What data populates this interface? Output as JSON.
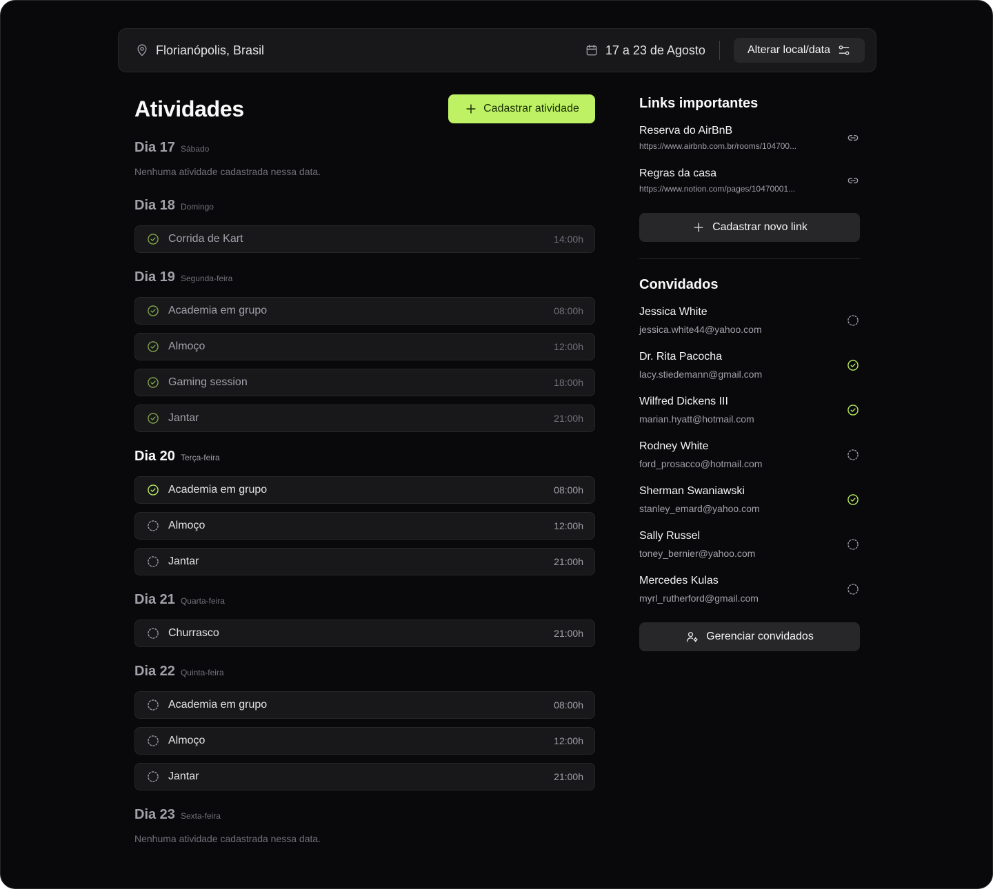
{
  "header": {
    "location": "Florianópolis, Brasil",
    "dates": "17 a 23 de Agosto",
    "change_label": "Alterar local/data"
  },
  "activities": {
    "title": "Atividades",
    "add_label": "Cadastrar atividade",
    "empty_text": "Nenhuma atividade cadastrada nessa data.",
    "days": [
      {
        "label": "Dia 17",
        "weekday": "Sábado",
        "active": false,
        "items": []
      },
      {
        "label": "Dia 18",
        "weekday": "Domingo",
        "active": false,
        "items": [
          {
            "name": "Corrida de Kart",
            "time": "14:00h",
            "done": true,
            "past": true
          }
        ]
      },
      {
        "label": "Dia 19",
        "weekday": "Segunda-feira",
        "active": false,
        "items": [
          {
            "name": "Academia em grupo",
            "time": "08:00h",
            "done": true,
            "past": true
          },
          {
            "name": "Almoço",
            "time": "12:00h",
            "done": true,
            "past": true
          },
          {
            "name": "Gaming session",
            "time": "18:00h",
            "done": true,
            "past": true
          },
          {
            "name": "Jantar",
            "time": "21:00h",
            "done": true,
            "past": true
          }
        ]
      },
      {
        "label": "Dia 20",
        "weekday": "Terça-feira",
        "active": true,
        "items": [
          {
            "name": "Academia em grupo",
            "time": "08:00h",
            "done": true,
            "past": false
          },
          {
            "name": "Almoço",
            "time": "12:00h",
            "done": false,
            "past": false
          },
          {
            "name": "Jantar",
            "time": "21:00h",
            "done": false,
            "past": false
          }
        ]
      },
      {
        "label": "Dia 21",
        "weekday": "Quarta-feira",
        "active": false,
        "items": [
          {
            "name": "Churrasco",
            "time": "21:00h",
            "done": false,
            "past": false
          }
        ]
      },
      {
        "label": "Dia 22",
        "weekday": "Quinta-feira",
        "active": false,
        "items": [
          {
            "name": "Academia em grupo",
            "time": "08:00h",
            "done": false,
            "past": false
          },
          {
            "name": "Almoço",
            "time": "12:00h",
            "done": false,
            "past": false
          },
          {
            "name": "Jantar",
            "time": "21:00h",
            "done": false,
            "past": false
          }
        ]
      },
      {
        "label": "Dia 23",
        "weekday": "Sexta-feira",
        "active": false,
        "items": []
      }
    ]
  },
  "links": {
    "title": "Links importantes",
    "items": [
      {
        "title": "Reserva do AirBnB",
        "url": "https://www.airbnb.com.br/rooms/104700..."
      },
      {
        "title": "Regras da casa",
        "url": "https://www.notion.com/pages/10470001..."
      }
    ],
    "add_label": "Cadastrar novo link"
  },
  "guests": {
    "title": "Convidados",
    "items": [
      {
        "name": "Jessica White",
        "email": "jessica.white44@yahoo.com",
        "confirmed": false
      },
      {
        "name": "Dr. Rita Pacocha",
        "email": "lacy.stiedemann@gmail.com",
        "confirmed": true
      },
      {
        "name": "Wilfred Dickens III",
        "email": "marian.hyatt@hotmail.com",
        "confirmed": true
      },
      {
        "name": "Rodney White",
        "email": "ford_prosacco@hotmail.com",
        "confirmed": false
      },
      {
        "name": "Sherman Swaniawski",
        "email": "stanley_emard@yahoo.com",
        "confirmed": true
      },
      {
        "name": "Sally Russel",
        "email": "toney_bernier@yahoo.com",
        "confirmed": false
      },
      {
        "name": "Mercedes Kulas",
        "email": "myrl_rutherford@gmail.com",
        "confirmed": false
      }
    ],
    "manage_label": "Gerenciar convidados"
  },
  "colors": {
    "accent": "#bef264",
    "check_past": "#84a94a",
    "pending": "#a1a1aa"
  },
  "icons": {
    "location": "map-pin-icon",
    "calendar": "calendar-icon",
    "settings": "sliders-icon",
    "add": "plus-icon",
    "done": "circle-check-icon",
    "pending": "circle-dashed-icon",
    "link": "link-icon",
    "manage": "user-cog-icon"
  }
}
